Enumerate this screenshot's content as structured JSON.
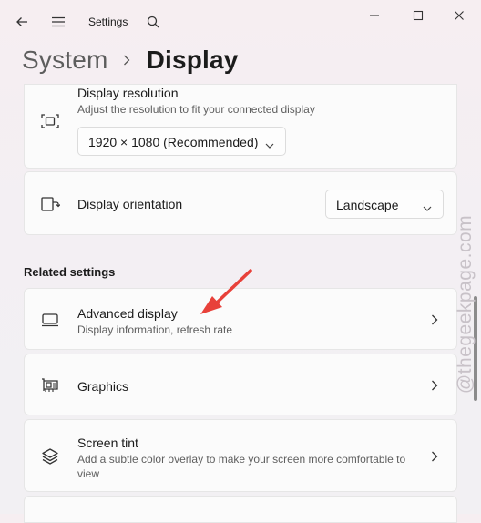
{
  "titlebar": {
    "back_icon": "back-arrow-icon",
    "menu_icon": "hamburger-menu-icon",
    "app_title": "Settings",
    "search_icon": "search-icon",
    "minimize_icon": "minimize-icon",
    "maximize_icon": "maximize-icon",
    "close_icon": "close-icon"
  },
  "breadcrumb": {
    "parent": "System",
    "current": "Display"
  },
  "display_resolution": {
    "title": "Display resolution",
    "subtitle": "Adjust the resolution to fit your connected display",
    "selected": "1920 × 1080 (Recommended)"
  },
  "display_orientation": {
    "title": "Display orientation",
    "selected": "Landscape"
  },
  "related": {
    "heading": "Related settings",
    "items": [
      {
        "title": "Advanced display",
        "subtitle": "Display information, refresh rate",
        "icon": "monitor-icon"
      },
      {
        "title": "Graphics",
        "subtitle": "",
        "icon": "graphics-card-icon"
      },
      {
        "title": "Screen tint",
        "subtitle": "Add a subtle color overlay to make your screen more comfortable to view",
        "icon": "layers-icon"
      }
    ]
  },
  "annotation": {
    "arrow_color": "#e8413a"
  },
  "watermark": {
    "text": "@thegeekpage.com"
  },
  "colors": {
    "card_bg": "#fbfbfb",
    "window_bg": "#f4eff2"
  }
}
